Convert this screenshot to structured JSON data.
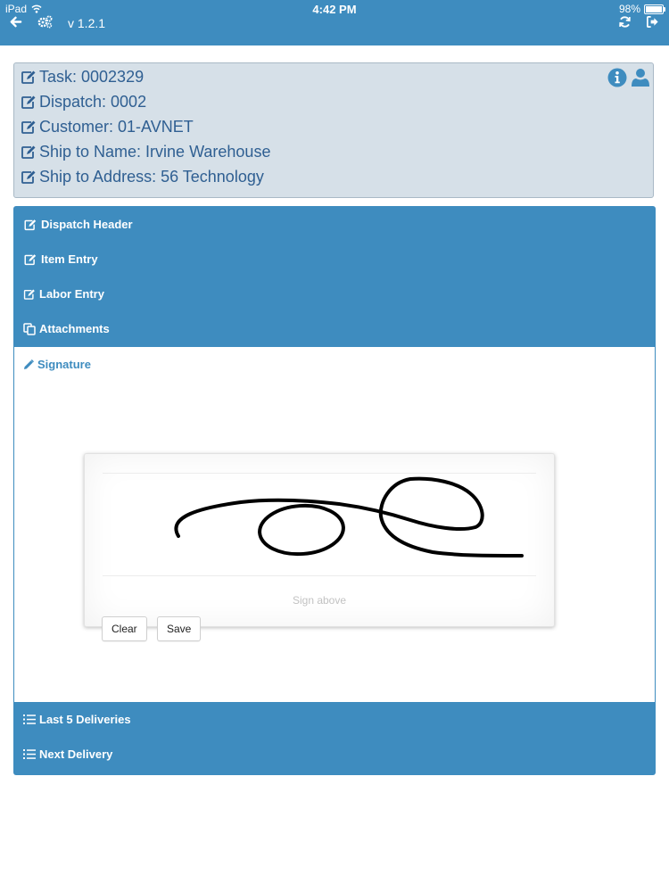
{
  "status_bar": {
    "device": "iPad",
    "time": "4:42 PM",
    "battery": "98%",
    "battery_level": 0.98
  },
  "app_bar": {
    "version": "v 1.2.1"
  },
  "info": {
    "task": "Task: 0002329",
    "dispatch": "Dispatch: 0002",
    "customer": "Customer: 01-AVNET",
    "ship_to_name": "Ship to Name: Irvine Warehouse",
    "ship_to_address": "Ship to Address: 56 Technology"
  },
  "sections": {
    "dispatch_header": "Dispatch Header",
    "item_entry": "Item Entry",
    "labor_entry": "Labor Entry",
    "attachments": "Attachments",
    "signature": "Signature",
    "last_deliveries": "Last 5 Deliveries",
    "next_delivery": "Next Delivery"
  },
  "signature_pad": {
    "hint": "Sign above",
    "clear_label": "Clear",
    "save_label": "Save"
  },
  "icons": {
    "back": "arrow-left-icon",
    "settings": "cogs-icon",
    "refresh": "refresh-icon",
    "logout": "sign-out-icon",
    "info": "info-circle-icon",
    "user": "user-icon",
    "edit": "edit-icon",
    "copy": "copy-icon",
    "pencil": "pencil-icon",
    "list": "list-icon"
  },
  "colors": {
    "primary": "#3e8cbf",
    "card_bg": "#d6e0e8",
    "card_text": "#2f5f92"
  }
}
